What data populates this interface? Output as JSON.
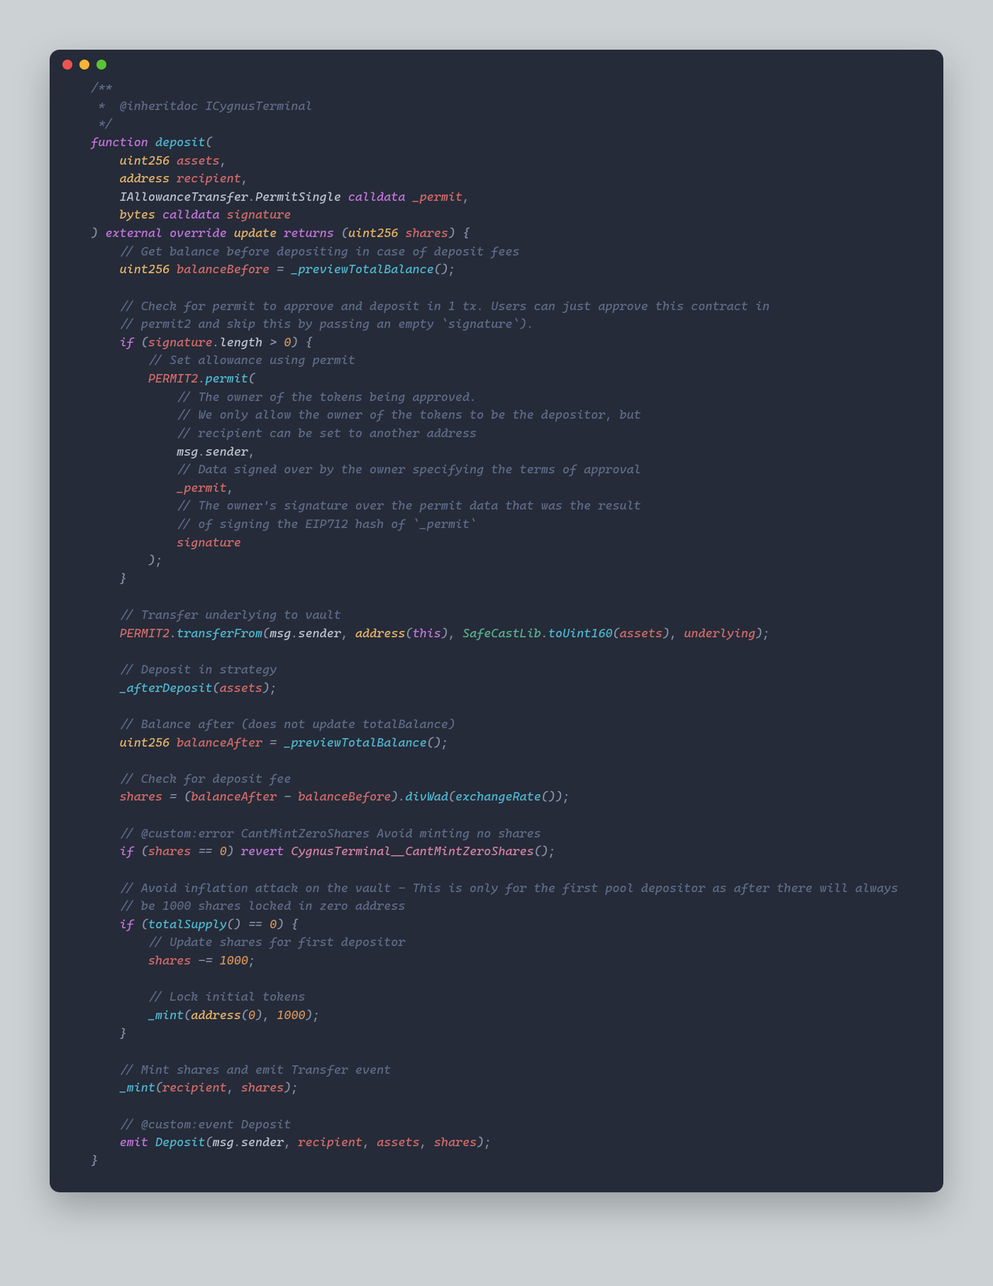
{
  "code_tokens": [
    [
      "    ",
      "cm",
      "/**"
    ],
    [
      "\n"
    ],
    [
      "     ",
      "cm",
      "*  @inheritdoc ICygnusTerminal"
    ],
    [
      "\n"
    ],
    [
      "     ",
      "cm",
      "*/"
    ],
    [
      "\n"
    ],
    [
      "    ",
      "kw",
      "function"
    ],
    [
      "tx",
      " "
    ],
    [
      "fn",
      "deposit"
    ],
    [
      "pn",
      "("
    ],
    [
      "\n"
    ],
    [
      "        ",
      "ty",
      "uint256"
    ],
    [
      "tx",
      " "
    ],
    [
      "id",
      "assets"
    ],
    [
      "pn",
      ","
    ],
    [
      "\n"
    ],
    [
      "        ",
      "ty",
      "address"
    ],
    [
      "tx",
      " "
    ],
    [
      "id",
      "recipient"
    ],
    [
      "pn",
      ","
    ],
    [
      "\n"
    ],
    [
      "        ",
      "tx",
      "IAllowanceTransfer"
    ],
    [
      "pn",
      "."
    ],
    [
      "tx",
      "PermitSingle "
    ],
    [
      "kw",
      "calldata"
    ],
    [
      "tx",
      " "
    ],
    [
      "id",
      "_permit"
    ],
    [
      "pn",
      ","
    ],
    [
      "\n"
    ],
    [
      "        ",
      "ty",
      "bytes"
    ],
    [
      "tx",
      " "
    ],
    [
      "kw",
      "calldata"
    ],
    [
      "tx",
      " "
    ],
    [
      "id",
      "signature"
    ],
    [
      "\n"
    ],
    [
      "    ",
      "pn",
      ")"
    ],
    [
      "tx",
      " "
    ],
    [
      "kw",
      "external"
    ],
    [
      "tx",
      " "
    ],
    [
      "kw",
      "override"
    ],
    [
      "tx",
      " "
    ],
    [
      "ty",
      "update"
    ],
    [
      "tx",
      " "
    ],
    [
      "kw",
      "returns"
    ],
    [
      "tx",
      " "
    ],
    [
      "pn",
      "("
    ],
    [
      "ty",
      "uint256"
    ],
    [
      "tx",
      " "
    ],
    [
      "id",
      "shares"
    ],
    [
      "pn",
      ")"
    ],
    [
      "tx",
      " "
    ],
    [
      "pn",
      "{"
    ],
    [
      "\n"
    ],
    [
      "        ",
      "cm",
      "// Get balance before depositing in case of deposit fees"
    ],
    [
      "\n"
    ],
    [
      "        ",
      "ty",
      "uint256"
    ],
    [
      "tx",
      " "
    ],
    [
      "id",
      "balanceBefore"
    ],
    [
      "tx",
      " "
    ],
    [
      "pn",
      "="
    ],
    [
      "tx",
      " "
    ],
    [
      "fn",
      "_previewTotalBalance"
    ],
    [
      "pn",
      "("
    ],
    [
      "pn",
      ")"
    ],
    [
      "pn",
      ";"
    ],
    [
      "\n"
    ],
    [
      "\n"
    ],
    [
      "        ",
      "cm",
      "// Check for permit to approve and deposit in 1 tx. Users can just approve this contract in"
    ],
    [
      "\n"
    ],
    [
      "        ",
      "cm",
      "// permit2 and skip this by passing an empty `signature`)."
    ],
    [
      "\n"
    ],
    [
      "        ",
      "kw",
      "if"
    ],
    [
      "tx",
      " "
    ],
    [
      "pn",
      "("
    ],
    [
      "id",
      "signature"
    ],
    [
      "pn",
      "."
    ],
    [
      "tx",
      "length"
    ],
    [
      "tx",
      " "
    ],
    [
      "pn",
      ">"
    ],
    [
      "tx",
      " "
    ],
    [
      "nm",
      "0"
    ],
    [
      "pn",
      ")"
    ],
    [
      "tx",
      " "
    ],
    [
      "pn",
      "{"
    ],
    [
      "\n"
    ],
    [
      "            ",
      "cm",
      "// Set allowance using permit"
    ],
    [
      "\n"
    ],
    [
      "            ",
      "id",
      "PERMIT2"
    ],
    [
      "pn",
      "."
    ],
    [
      "fn",
      "permit"
    ],
    [
      "pn",
      "("
    ],
    [
      "\n"
    ],
    [
      "                ",
      "cm",
      "// The owner of the tokens being approved."
    ],
    [
      "\n"
    ],
    [
      "                ",
      "cm",
      "// We only allow the owner of the tokens to be the depositor, but"
    ],
    [
      "\n"
    ],
    [
      "                ",
      "cm",
      "// recipient can be set to another address"
    ],
    [
      "\n"
    ],
    [
      "                ",
      "tx",
      "msg"
    ],
    [
      "pn",
      "."
    ],
    [
      "tx",
      "sender"
    ],
    [
      "pn",
      ","
    ],
    [
      "\n"
    ],
    [
      "                ",
      "cm",
      "// Data signed over by the owner specifying the terms of approval"
    ],
    [
      "\n"
    ],
    [
      "                ",
      "id",
      "_permit"
    ],
    [
      "pn",
      ","
    ],
    [
      "\n"
    ],
    [
      "                ",
      "cm",
      "// The owner's signature over the permit data that was the result"
    ],
    [
      "\n"
    ],
    [
      "                ",
      "cm",
      "// of signing the EIP712 hash of `_permit`"
    ],
    [
      "\n"
    ],
    [
      "                ",
      "id",
      "signature"
    ],
    [
      "\n"
    ],
    [
      "            ",
      "pn",
      ")"
    ],
    [
      "pn",
      ";"
    ],
    [
      "\n"
    ],
    [
      "        ",
      "pn",
      "}"
    ],
    [
      "\n"
    ],
    [
      "\n"
    ],
    [
      "        ",
      "cm",
      "// Transfer underlying to vault"
    ],
    [
      "\n"
    ],
    [
      "        ",
      "id",
      "PERMIT2"
    ],
    [
      "pn",
      "."
    ],
    [
      "fn",
      "transferFrom"
    ],
    [
      "pn",
      "("
    ],
    [
      "tx",
      "msg"
    ],
    [
      "pn",
      "."
    ],
    [
      "tx",
      "sender"
    ],
    [
      "pn",
      ","
    ],
    [
      "tx",
      " "
    ],
    [
      "ty",
      "address"
    ],
    [
      "pn",
      "("
    ],
    [
      "kw",
      "this"
    ],
    [
      "pn",
      ")"
    ],
    [
      "pn",
      ","
    ],
    [
      "tx",
      " "
    ],
    [
      "lb",
      "SafeCastLib"
    ],
    [
      "pn",
      "."
    ],
    [
      "fn",
      "toUint160"
    ],
    [
      "pn",
      "("
    ],
    [
      "id",
      "assets"
    ],
    [
      "pn",
      ")"
    ],
    [
      "pn",
      ","
    ],
    [
      "tx",
      " "
    ],
    [
      "id",
      "underlying"
    ],
    [
      "pn",
      ")"
    ],
    [
      "pn",
      ";"
    ],
    [
      "\n"
    ],
    [
      "\n"
    ],
    [
      "        ",
      "cm",
      "// Deposit in strategy"
    ],
    [
      "\n"
    ],
    [
      "        ",
      "fn",
      "_afterDeposit"
    ],
    [
      "pn",
      "("
    ],
    [
      "id",
      "assets"
    ],
    [
      "pn",
      ")"
    ],
    [
      "pn",
      ";"
    ],
    [
      "\n"
    ],
    [
      "\n"
    ],
    [
      "        ",
      "cm",
      "// Balance after (does not update totalBalance)"
    ],
    [
      "\n"
    ],
    [
      "        ",
      "ty",
      "uint256"
    ],
    [
      "tx",
      " "
    ],
    [
      "id",
      "balanceAfter"
    ],
    [
      "tx",
      " "
    ],
    [
      "pn",
      "="
    ],
    [
      "tx",
      " "
    ],
    [
      "fn",
      "_previewTotalBalance"
    ],
    [
      "pn",
      "("
    ],
    [
      "pn",
      ")"
    ],
    [
      "pn",
      ";"
    ],
    [
      "\n"
    ],
    [
      "\n"
    ],
    [
      "        ",
      "cm",
      "// Check for deposit fee"
    ],
    [
      "\n"
    ],
    [
      "        ",
      "id",
      "shares"
    ],
    [
      "tx",
      " "
    ],
    [
      "pn",
      "="
    ],
    [
      "tx",
      " "
    ],
    [
      "pn",
      "("
    ],
    [
      "id",
      "balanceAfter"
    ],
    [
      "tx",
      " "
    ],
    [
      "pn",
      "-"
    ],
    [
      "tx",
      " "
    ],
    [
      "id",
      "balanceBefore"
    ],
    [
      "pn",
      ")"
    ],
    [
      "pn",
      "."
    ],
    [
      "fn",
      "divWad"
    ],
    [
      "pn",
      "("
    ],
    [
      "fn",
      "exchangeRate"
    ],
    [
      "pn",
      "("
    ],
    [
      "pn",
      ")"
    ],
    [
      "pn",
      ")"
    ],
    [
      "pn",
      ";"
    ],
    [
      "\n"
    ],
    [
      "\n"
    ],
    [
      "        ",
      "cm",
      "// @custom:error CantMintZeroShares Avoid minting no shares"
    ],
    [
      "\n"
    ],
    [
      "        ",
      "kw",
      "if"
    ],
    [
      "tx",
      " "
    ],
    [
      "pn",
      "("
    ],
    [
      "id",
      "shares"
    ],
    [
      "tx",
      " "
    ],
    [
      "pn",
      "=="
    ],
    [
      "tx",
      " "
    ],
    [
      "nm",
      "0"
    ],
    [
      "pn",
      ")"
    ],
    [
      "tx",
      " "
    ],
    [
      "kw",
      "revert"
    ],
    [
      "tx",
      " "
    ],
    [
      "pk",
      "CygnusTerminal__CantMintZeroShares"
    ],
    [
      "pn",
      "("
    ],
    [
      "pn",
      ")"
    ],
    [
      "pn",
      ";"
    ],
    [
      "\n"
    ],
    [
      "\n"
    ],
    [
      "        ",
      "cm",
      "// Avoid inflation attack on the vault - This is only for the first pool depositor as after there will always"
    ],
    [
      "\n"
    ],
    [
      "        ",
      "cm",
      "// be 1000 shares locked in zero address"
    ],
    [
      "\n"
    ],
    [
      "        ",
      "kw",
      "if"
    ],
    [
      "tx",
      " "
    ],
    [
      "pn",
      "("
    ],
    [
      "fn",
      "totalSupply"
    ],
    [
      "pn",
      "("
    ],
    [
      "pn",
      ")"
    ],
    [
      "tx",
      " "
    ],
    [
      "pn",
      "=="
    ],
    [
      "tx",
      " "
    ],
    [
      "nm",
      "0"
    ],
    [
      "pn",
      ")"
    ],
    [
      "tx",
      " "
    ],
    [
      "pn",
      "{"
    ],
    [
      "\n"
    ],
    [
      "            ",
      "cm",
      "// Update shares for first depositor"
    ],
    [
      "\n"
    ],
    [
      "            ",
      "id",
      "shares"
    ],
    [
      "tx",
      " "
    ],
    [
      "pn",
      "-="
    ],
    [
      "tx",
      " "
    ],
    [
      "nm",
      "1000"
    ],
    [
      "pn",
      ";"
    ],
    [
      "\n"
    ],
    [
      "\n"
    ],
    [
      "            ",
      "cm",
      "// Lock initial tokens"
    ],
    [
      "\n"
    ],
    [
      "            ",
      "fn",
      "_mint"
    ],
    [
      "pn",
      "("
    ],
    [
      "ty",
      "address"
    ],
    [
      "pn",
      "("
    ],
    [
      "nm",
      "0"
    ],
    [
      "pn",
      ")"
    ],
    [
      "pn",
      ","
    ],
    [
      "tx",
      " "
    ],
    [
      "nm",
      "1000"
    ],
    [
      "pn",
      ")"
    ],
    [
      "pn",
      ";"
    ],
    [
      "\n"
    ],
    [
      "        ",
      "pn",
      "}"
    ],
    [
      "\n"
    ],
    [
      "\n"
    ],
    [
      "        ",
      "cm",
      "// Mint shares and emit Transfer event"
    ],
    [
      "\n"
    ],
    [
      "        ",
      "fn",
      "_mint"
    ],
    [
      "pn",
      "("
    ],
    [
      "id",
      "recipient"
    ],
    [
      "pn",
      ","
    ],
    [
      "tx",
      " "
    ],
    [
      "id",
      "shares"
    ],
    [
      "pn",
      ")"
    ],
    [
      "pn",
      ";"
    ],
    [
      "\n"
    ],
    [
      "\n"
    ],
    [
      "        ",
      "cm",
      "// @custom:event Deposit"
    ],
    [
      "\n"
    ],
    [
      "        ",
      "kw",
      "emit"
    ],
    [
      "tx",
      " "
    ],
    [
      "fn",
      "Deposit"
    ],
    [
      "pn",
      "("
    ],
    [
      "tx",
      "msg"
    ],
    [
      "pn",
      "."
    ],
    [
      "tx",
      "sender"
    ],
    [
      "pn",
      ","
    ],
    [
      "tx",
      " "
    ],
    [
      "id",
      "recipient"
    ],
    [
      "pn",
      ","
    ],
    [
      "tx",
      " "
    ],
    [
      "id",
      "assets"
    ],
    [
      "pn",
      ","
    ],
    [
      "tx",
      " "
    ],
    [
      "id",
      "shares"
    ],
    [
      "pn",
      ")"
    ],
    [
      "pn",
      ";"
    ],
    [
      "\n"
    ],
    [
      "    ",
      "pn",
      "}"
    ]
  ]
}
